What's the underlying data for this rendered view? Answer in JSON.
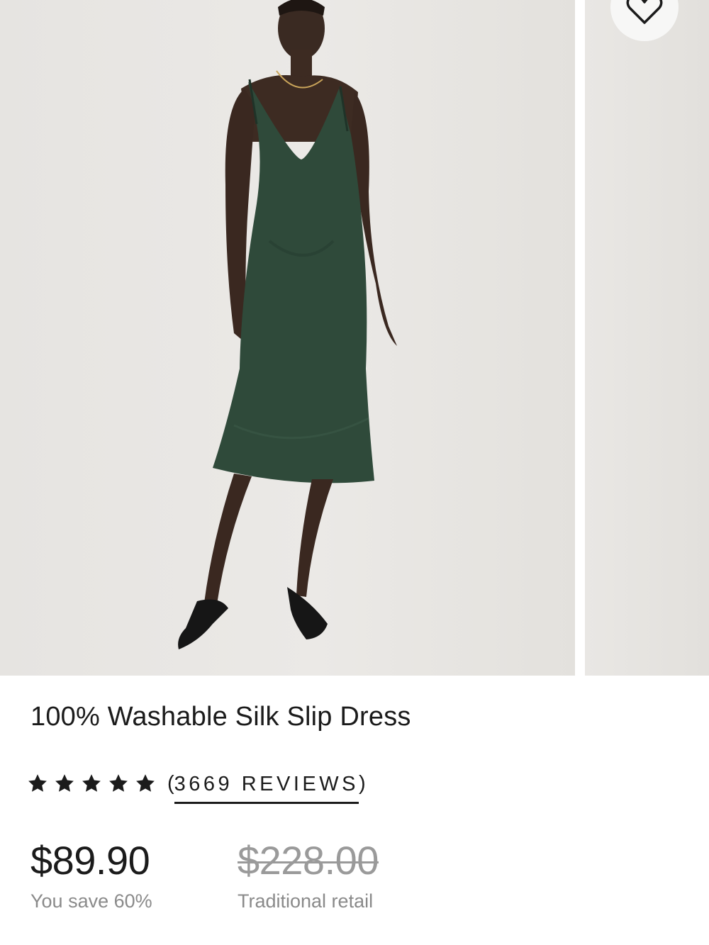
{
  "product": {
    "title": "100% Washable Silk Slip Dress",
    "rating_stars": 5,
    "reviews_count_label": "3669 REVIEWS",
    "paren_open": "(",
    "paren_close": ")"
  },
  "pricing": {
    "current_price": "$89.90",
    "savings_label": "You save 60%",
    "original_price": "$228.00",
    "original_label": "Traditional retail"
  },
  "icons": {
    "wishlist": "heart-outline-icon",
    "rating": "star-icon"
  },
  "colors": {
    "dress": "#2f4a3a",
    "text": "#1b1b1b",
    "muted": "#8a8a8a",
    "strike": "#9a9a9a"
  }
}
